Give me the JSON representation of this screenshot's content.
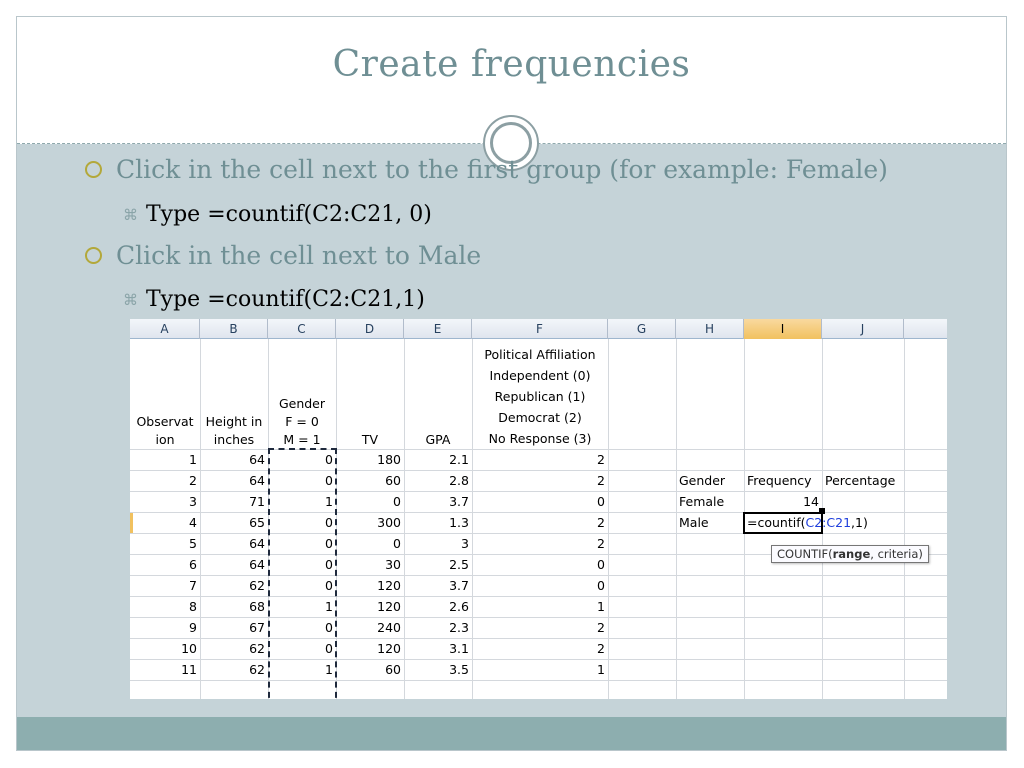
{
  "slide": {
    "title": "Create frequencies",
    "bullets": [
      {
        "text": "Click in the cell next to the first group (for example: Female)",
        "sub": "Type =countif(C2:C21, 0)"
      },
      {
        "text": "Click in the cell next to Male",
        "sub": "Type =countif(C2:C21,1)"
      }
    ]
  },
  "spreadsheet": {
    "column_letters": [
      "A",
      "B",
      "C",
      "D",
      "E",
      "F",
      "G",
      "H",
      "I",
      "J"
    ],
    "selected_column": "I",
    "headers": {
      "A": [
        "Observat",
        "ion"
      ],
      "B": [
        "Height in",
        "inches"
      ],
      "C": [
        "Gender",
        "F = 0",
        "M = 1"
      ],
      "D": [
        "TV"
      ],
      "E": [
        "GPA"
      ],
      "F": [
        "Political Affiliation",
        "Independent (0)",
        "Republican (1)",
        "Democrat (2)",
        "No Response (3)"
      ]
    },
    "rows": [
      [
        "1",
        "64",
        "0",
        "180",
        "2.1",
        "2"
      ],
      [
        "2",
        "64",
        "0",
        "60",
        "2.8",
        "2"
      ],
      [
        "3",
        "71",
        "1",
        "0",
        "3.7",
        "0"
      ],
      [
        "4",
        "65",
        "0",
        "300",
        "1.3",
        "2"
      ],
      [
        "5",
        "64",
        "0",
        "0",
        "3",
        "2"
      ],
      [
        "6",
        "64",
        "0",
        "30",
        "2.5",
        "0"
      ],
      [
        "7",
        "62",
        "0",
        "120",
        "3.7",
        "0"
      ],
      [
        "8",
        "68",
        "1",
        "120",
        "2.6",
        "1"
      ],
      [
        "9",
        "67",
        "0",
        "240",
        "2.3",
        "2"
      ],
      [
        "10",
        "62",
        "0",
        "120",
        "3.1",
        "2"
      ],
      [
        "11",
        "62",
        "1",
        "60",
        "3.5",
        "1"
      ]
    ],
    "freq_table": {
      "header_gender": "Gender",
      "header_frequency": "Frequency",
      "header_percentage": "Percentage",
      "female_label": "Female",
      "female_value": "14",
      "male_label": "Male"
    },
    "formula": {
      "prefix": "=countif(",
      "ref": "C2:C21",
      "suffix": ",1)"
    },
    "tooltip": {
      "fn": "COUNTIF(",
      "arg1": "range",
      "rest": ", criteria)"
    }
  }
}
